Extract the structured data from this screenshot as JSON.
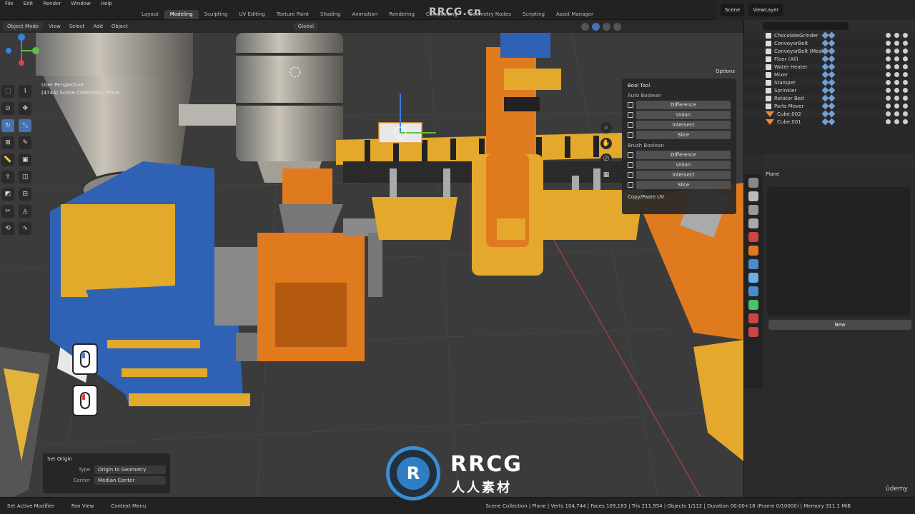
{
  "topbar": {
    "menus": [
      "File",
      "Edit",
      "Render",
      "Window",
      "Help"
    ],
    "workspaces": [
      "Layout",
      "Modeling",
      "Sculpting",
      "UV Editing",
      "Texture Paint",
      "Shading",
      "Animation",
      "Rendering",
      "Compositing",
      "Geometry Nodes",
      "Scripting",
      "Asset Manager"
    ],
    "active_workspace": "Modeling",
    "scene": "Scene",
    "view_layer": "ViewLayer",
    "watermark": "RRCG.cn"
  },
  "viewport_header": {
    "mode": "Object Mode",
    "view": "View",
    "select": "Select",
    "add": "Add",
    "object": "Object",
    "orientation": "Global",
    "options": "Options"
  },
  "viewport_info": {
    "line1": "User Perspective",
    "line2": "(4744) Scene Collection | Plane"
  },
  "bool_tool": {
    "title": "Bool Tool",
    "auto_section": "Auto Boolean",
    "auto_buttons": [
      "Difference",
      "Union",
      "Intersect",
      "Slice"
    ],
    "brush_section": "Brush Boolean",
    "brush_buttons": [
      "Difference",
      "Union",
      "Intersect",
      "Slice"
    ],
    "copy_paste": "Copy/Paste UV"
  },
  "operator_panel": {
    "title": "Set Origin",
    "type_label": "Type",
    "type_value": "Origin to Geometry",
    "center_label": "Center",
    "center_value": "Median Center"
  },
  "outliner": {
    "items": [
      {
        "name": "ChocolateGrinder",
        "kind": "mesh"
      },
      {
        "name": "ConveyorBelt",
        "kind": "mesh"
      },
      {
        "name": "ConveyorBelt (Mesh)",
        "kind": "mesh"
      },
      {
        "name": "Floor (All)",
        "kind": "mesh"
      },
      {
        "name": "Water Heater",
        "kind": "mesh"
      },
      {
        "name": "Mixer",
        "kind": "mesh"
      },
      {
        "name": "Stamper",
        "kind": "mesh"
      },
      {
        "name": "Sprinkler",
        "kind": "mesh"
      },
      {
        "name": "Rotator Bed",
        "kind": "mesh"
      },
      {
        "name": "Parts Mover",
        "kind": "mesh"
      },
      {
        "name": "Cube.002",
        "kind": "tri"
      },
      {
        "name": "Cube.001",
        "kind": "tri"
      }
    ]
  },
  "properties": {
    "object_name": "Plane",
    "new_button": "New",
    "brand": "ûdemy"
  },
  "statusbar": {
    "left1": "Set Active Modifier",
    "left2": "Pan View",
    "left3": "Context Menu",
    "stats": "Scene Collection | Plane | Verts 104,744 | Faces 109,183 | Tris 211,954 | Objects 1/112 | Duration 00:00+18 (Frame 0/10000) | Memory 311.1 MiB"
  },
  "logo": {
    "mark": "R",
    "name": "RRCG",
    "subtitle": "人人素材"
  }
}
